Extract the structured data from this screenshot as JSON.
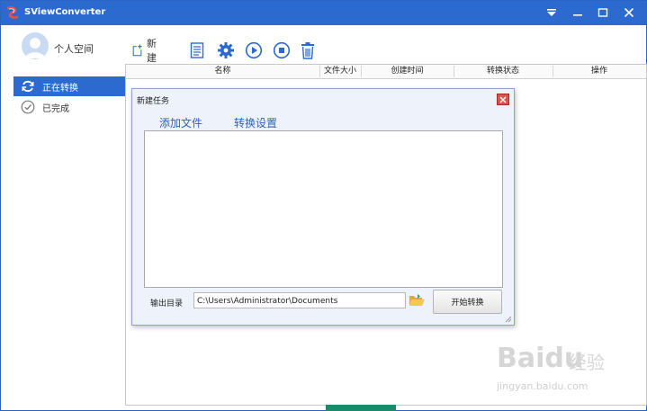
{
  "app": {
    "title": "SViewConverter",
    "accent_color": "#2d6ad0"
  },
  "window_controls": [
    {
      "name": "dropdown-icon"
    },
    {
      "name": "minimize-icon"
    },
    {
      "name": "maximize-icon"
    },
    {
      "name": "close-icon"
    }
  ],
  "user": {
    "label": "个人空间",
    "icon": "avatar-icon"
  },
  "toolbar": {
    "new_label": "新建",
    "icons": [
      "new-task-icon",
      "document-list-icon",
      "gear-icon",
      "play-icon",
      "stop-icon",
      "delete-icon"
    ]
  },
  "sidebar": {
    "items": [
      {
        "label": "正在转换",
        "icon": "sync-icon",
        "active": true
      },
      {
        "label": "已完成",
        "icon": "check-circle-icon",
        "active": false
      }
    ]
  },
  "table": {
    "columns": [
      "名称",
      "文件大小",
      "创建时间",
      "转换状态",
      "操作"
    ],
    "rows": []
  },
  "dialog": {
    "title": "新建任务",
    "tabs": [
      "添加文件",
      "转换设置"
    ],
    "output_label": "输出目录",
    "output_path": "C:\\Users\\Administrator\\Documents",
    "start_button": "开始转换"
  },
  "watermark": {
    "brand": "Bai",
    "brand2": "du",
    "cn": "经验",
    "url": "jingyan.baidu.com"
  }
}
